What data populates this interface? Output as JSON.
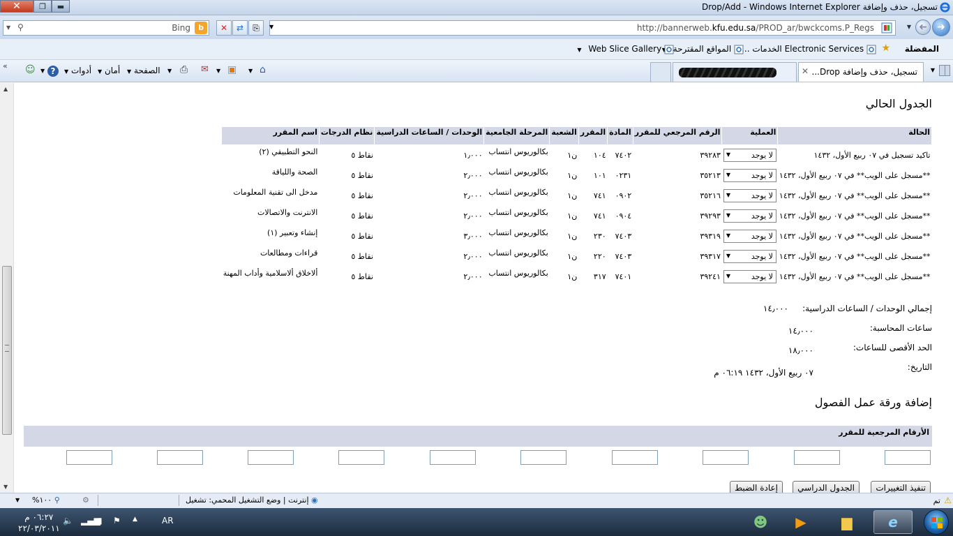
{
  "window": {
    "title": "تسجيل، حذف وإضافة Drop/Add - Windows Internet Explorer",
    "close_glyph": "✕",
    "max_glyph": "❐",
    "min_glyph": "▬"
  },
  "address_bar": {
    "url_prefix": "http://bannerweb.",
    "url_domain": "kfu.edu.sa",
    "url_suffix": "/PROD_ar/bwckcoms.P_Regs",
    "search_placeholder": "Bing",
    "back_glyph": "➜",
    "forward_glyph": "➜"
  },
  "favorites_bar": {
    "favorites_label": "المفضلة",
    "items": [
      {
        "label": "Electronic Services الخدمات ...",
        "icon": "ie-page-icon"
      },
      {
        "label": "المواقع المقترحة",
        "icon": "ie-page-icon"
      },
      {
        "label": "Web Slice Gallery",
        "icon": "ie-page-icon"
      }
    ]
  },
  "tabs": [
    {
      "label": "تسجيل، حذف وإضافة Drop...",
      "active": true
    },
    {
      "label": "",
      "active": false
    }
  ],
  "command_bar": {
    "page": "الصفحة",
    "safety": "أمان",
    "tools": "أدوات"
  },
  "page": {
    "current_schedule_heading": "الجدول الحالي",
    "table": {
      "headers": [
        "الحالة",
        "العملية",
        "الرقم المرجعي للمقرر",
        "المادة",
        "المقرر",
        "الشعبة",
        "المرحلة الجامعية",
        "الوحدات / الساعات الدراسية",
        "نظام الدرجات",
        "اسم المقرر"
      ],
      "rows": [
        {
          "status": "تاكيد تسجيل في ٠٧ ربيع الأول، ١٤٣٢",
          "action": "لا يوجد",
          "crn": "٣٩٢٨٣",
          "subject": "٧٤٠٢",
          "course": "١٠٤",
          "section": "ن١",
          "level": "بكالوريوس انتساب",
          "units": "١٫٠٠٠",
          "grading": "نقاط ٥",
          "title": "النحو التطبيقي (٢)"
        },
        {
          "status": "**مسجل على الويب** في ٠٧ ربيع الأول، ١٤٣٢",
          "action": "لا يوجد",
          "crn": "٣٥٢١٣",
          "subject": "٠٢٣١",
          "course": "١٠١",
          "section": "ن١",
          "level": "بكالوريوس انتساب",
          "units": "٢٫٠٠٠",
          "grading": "نقاط ٥",
          "title": "الصحة واللياقة"
        },
        {
          "status": "**مسجل على الويب** في ٠٧ ربيع الأول، ١٤٣٢",
          "action": "لا يوجد",
          "crn": "٣٥٢١٦",
          "subject": "٠٩٠٢",
          "course": "٧٤١",
          "section": "ن١",
          "level": "بكالوريوس انتساب",
          "units": "٢٫٠٠٠",
          "grading": "نقاط ٥",
          "title": "مدخل الى تقنية المعلومات"
        },
        {
          "status": "**مسجل على الويب** في ٠٧ ربيع الأول، ١٤٣٢",
          "action": "لا يوجد",
          "crn": "٣٩٢٩٣",
          "subject": "٠٩٠٤",
          "course": "٧٤١",
          "section": "ن١",
          "level": "بكالوريوس انتساب",
          "units": "٢٫٠٠٠",
          "grading": "نقاط ٥",
          "title": "الانترنت والاتصالات"
        },
        {
          "status": "**مسجل على الويب** في ٠٧ ربيع الأول، ١٤٣٢",
          "action": "لا يوجد",
          "crn": "٣٩٣١٩",
          "subject": "٧٤٠٣",
          "course": "٢٣٠",
          "section": "ن١",
          "level": "بكالوريوس انتساب",
          "units": "٣٫٠٠٠",
          "grading": "نقاط ٥",
          "title": "إنشاء وتعبير (١)"
        },
        {
          "status": "**مسجل على الويب** في ٠٧ ربيع الأول، ١٤٣٢",
          "action": "لا يوجد",
          "crn": "٣٩٣١٧",
          "subject": "٧٤٠٣",
          "course": "٢٢٠",
          "section": "ن١",
          "level": "بكالوريوس انتساب",
          "units": "٢٫٠٠٠",
          "grading": "نقاط ٥",
          "title": "قراءات ومطالعات"
        },
        {
          "status": "**مسجل على الويب** في ٠٧ ربيع الأول، ١٤٣٢",
          "action": "لا يوجد",
          "crn": "٣٩٢٤١",
          "subject": "٧٤٠١",
          "course": "٣١٧",
          "section": "ن١",
          "level": "بكالوريوس انتساب",
          "units": "٢٫٠٠٠",
          "grading": "نقاط ٥",
          "title": "ألاخلاق ألاسلامية وأداب المهنة"
        }
      ]
    },
    "summary": {
      "total_units_label": "إجمالي الوحدات / الساعات الدراسية:",
      "total_units_value": "١٤٫٠٠٠",
      "billing_hours_label": "ساعات المحاسبة:",
      "billing_hours_value": "١٤٫٠٠٠",
      "max_hours_label": "الحد الأقصى للساعات:",
      "max_hours_value": "١٨٫٠٠٠",
      "date_label": "التاريخ:",
      "date_value": "٠٧ ربيع الأول، ١٤٣٢ ٠٦:١٩ م"
    },
    "add_worksheet_heading": "إضافة ورقة عمل الفصول",
    "crn_header": "الأرقام المرجعية للمقرر",
    "buttons": {
      "submit": "تنفيذ التغييرات",
      "class_schedule": "الجدول الدراسي",
      "reset": "إعادة الضبط"
    }
  },
  "status_bar": {
    "done": "تم",
    "zone": "إنترنت | وضع التشغيل المحمي: تشغيل",
    "zoom": "%١٠٠"
  },
  "taskbar": {
    "language": "AR",
    "time": "٠٦:٢٧ م",
    "date": "٢٢/٠٣/٢٠١١"
  }
}
